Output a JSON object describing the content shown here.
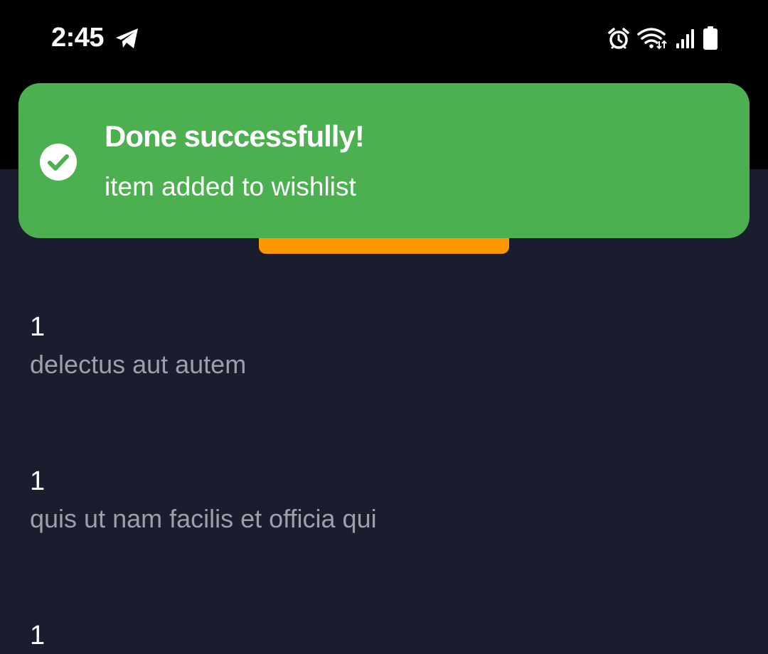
{
  "status_bar": {
    "time": "2:45",
    "icons": [
      "telegram-icon",
      "alarm-icon",
      "wifi-icon",
      "signal-icon",
      "battery-icon"
    ]
  },
  "toast": {
    "title": "Done successfully!",
    "message": "item added to wishlist",
    "icon": "check-circle-icon",
    "color": "#4caf50"
  },
  "action_button": {
    "color": "#ff9800"
  },
  "list": {
    "items": [
      {
        "number": "1",
        "title": "delectus aut autem"
      },
      {
        "number": "1",
        "title": "quis ut nam facilis et officia qui"
      },
      {
        "number": "1",
        "title": ""
      }
    ]
  },
  "colors": {
    "background": "#1a1d2e",
    "header": "#000000",
    "secondary_text": "#9e9faa"
  }
}
